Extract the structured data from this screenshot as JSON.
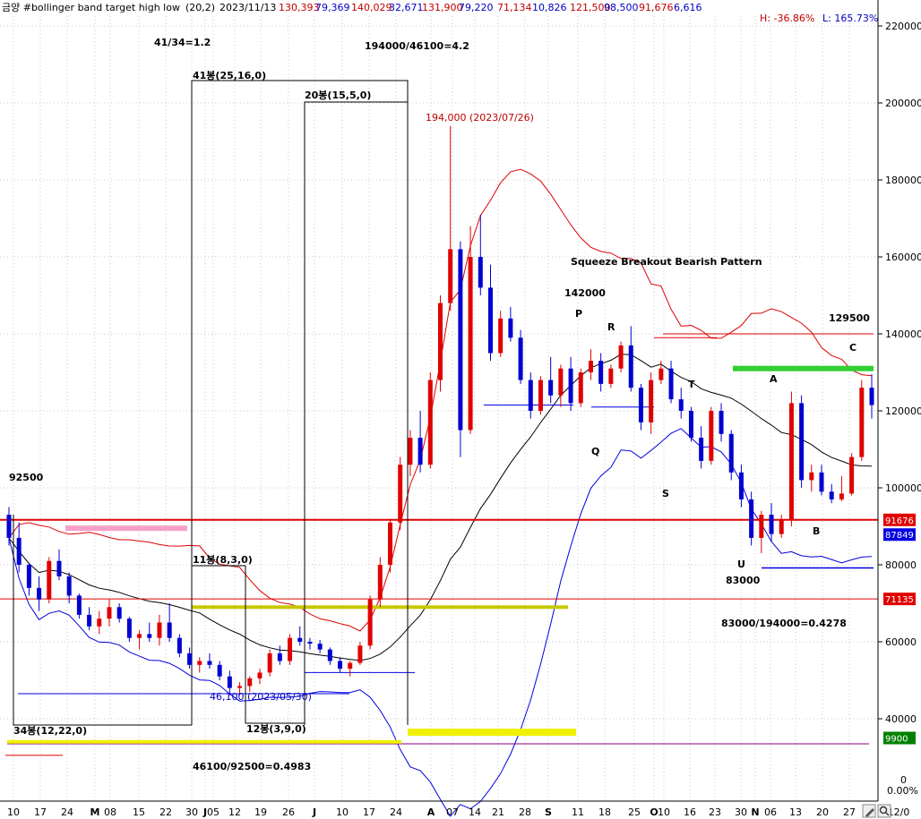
{
  "header": {
    "name": "금양 #bollinger band target high low",
    "params": "(20,2)",
    "date": "2023/11/13",
    "v1": "130,393",
    "v2": "79,369",
    "v3": "140,029",
    "v4": "32,671",
    "v5": "131,900",
    "v6": "79,220",
    "v7": "71,134",
    "v8": "10,826",
    "v9": "121,500",
    "v10": "98,500",
    "v11": "91,676",
    "v12": "6,616",
    "hi_pct": "H: -36.86%",
    "lo_pct": "L: 165.73%"
  },
  "chart_data": {
    "type": "candlestick",
    "title": "",
    "ylim": [
      30000,
      225000
    ],
    "y_ticks": [
      40000,
      60000,
      80000,
      100000,
      120000,
      140000,
      160000,
      180000,
      200000,
      220000
    ],
    "x_tick_labels": [
      "10",
      "17",
      "24",
      "M",
      "08",
      "15",
      "22",
      "30",
      "J",
      "05",
      "12",
      "19",
      "26",
      "J",
      "10",
      "17",
      "24",
      "A",
      "07",
      "14",
      "21",
      "28",
      "S",
      "11",
      "18",
      "25",
      "O",
      "10",
      "16",
      "23",
      "30",
      "N",
      "06",
      "13",
      "20",
      "27",
      "12/0"
    ],
    "grid": true,
    "price_tags": [
      {
        "text": "91676",
        "value": 91676,
        "color": "#e00000"
      },
      {
        "text": "87849",
        "value": 87849,
        "color": "#0000e0"
      },
      {
        "text": "71135",
        "value": 71135,
        "color": "#e00000"
      },
      {
        "text": "9900",
        "value": 35000,
        "color": "#008000"
      }
    ],
    "annotations": [
      {
        "text": "41/34=1.2"
      },
      {
        "text": "194000/46100=4.2"
      },
      {
        "text": "41봉(25,16,0)"
      },
      {
        "text": "20봉(15,5,0)"
      },
      {
        "text": "194,000 (2023/07/26)"
      },
      {
        "text": "Squeeze Breakout Bearish Pattern"
      },
      {
        "text": "142000"
      },
      {
        "text": "P"
      },
      {
        "text": "R"
      },
      {
        "text": "Q"
      },
      {
        "text": "T"
      },
      {
        "text": "S"
      },
      {
        "text": "U"
      },
      {
        "text": "A"
      },
      {
        "text": "B"
      },
      {
        "text": "C"
      },
      {
        "text": "83000"
      },
      {
        "text": "129500"
      },
      {
        "text": "92500"
      },
      {
        "text": "11봉(8,3,0)"
      },
      {
        "text": "46,100 (2023/05/30)"
      },
      {
        "text": "34봉(12,22,0)"
      },
      {
        "text": "12봉(3,9,0)"
      },
      {
        "text": "46100/92500=0.4983"
      },
      {
        "text": "83000/194000=0.4278"
      }
    ],
    "extra_tag": "0",
    "extra_pct": "0.00%",
    "candles": [
      [
        93000,
        95000,
        85000,
        87000
      ],
      [
        87000,
        91000,
        78000,
        80000
      ],
      [
        80000,
        80500,
        72000,
        74000
      ],
      [
        74000,
        77000,
        68000,
        71000
      ],
      [
        71000,
        82000,
        70000,
        81000
      ],
      [
        81000,
        84000,
        76000,
        77000
      ],
      [
        77000,
        78000,
        70000,
        72000
      ],
      [
        72000,
        72500,
        66000,
        67000
      ],
      [
        67000,
        69000,
        63000,
        64000
      ],
      [
        64000,
        68000,
        62000,
        66000
      ],
      [
        66000,
        71000,
        64000,
        69000
      ],
      [
        69000,
        70000,
        65000,
        66000
      ],
      [
        66000,
        66500,
        60000,
        61000
      ],
      [
        61000,
        63000,
        58000,
        62000
      ],
      [
        62000,
        65000,
        60000,
        61000
      ],
      [
        61000,
        67000,
        59000,
        65000
      ],
      [
        65000,
        70000,
        60000,
        61000
      ],
      [
        61000,
        62000,
        56000,
        57000
      ],
      [
        57000,
        58500,
        53000,
        54000
      ],
      [
        54000,
        56000,
        52000,
        55000
      ],
      [
        55000,
        57000,
        53000,
        54000
      ],
      [
        54000,
        55000,
        50000,
        51000
      ],
      [
        51000,
        52500,
        46100,
        48000
      ],
      [
        48000,
        49500,
        46100,
        48500
      ],
      [
        48500,
        51000,
        47000,
        50500
      ],
      [
        50500,
        53000,
        49000,
        52000
      ],
      [
        52000,
        58000,
        51000,
        57000
      ],
      [
        57000,
        59000,
        54000,
        55000
      ],
      [
        55000,
        62000,
        54000,
        61000
      ],
      [
        61000,
        64000,
        59000,
        60000
      ],
      [
        60000,
        61000,
        58000,
        59500
      ],
      [
        59500,
        60500,
        57000,
        58000
      ],
      [
        58000,
        58500,
        54000,
        55000
      ],
      [
        55000,
        56000,
        52000,
        53000
      ],
      [
        53000,
        55000,
        51000,
        54500
      ],
      [
        54500,
        60000,
        54000,
        59000
      ],
      [
        59000,
        72000,
        58000,
        71000
      ],
      [
        71000,
        82000,
        69000,
        80000
      ],
      [
        80000,
        92000,
        78000,
        91000
      ],
      [
        91000,
        108000,
        89000,
        106000
      ],
      [
        106000,
        115000,
        103000,
        113000
      ],
      [
        113000,
        120000,
        104000,
        106000
      ],
      [
        106000,
        130000,
        105000,
        128000
      ],
      [
        128000,
        150000,
        125000,
        148000
      ],
      [
        148000,
        194000,
        146000,
        162000
      ],
      [
        162000,
        164000,
        108000,
        115000
      ],
      [
        115000,
        168000,
        114000,
        160000
      ],
      [
        160000,
        171000,
        150000,
        152000
      ],
      [
        152000,
        158000,
        133000,
        135000
      ],
      [
        135000,
        146000,
        134000,
        144000
      ],
      [
        144000,
        147000,
        138000,
        139000
      ],
      [
        139000,
        141000,
        127000,
        128000
      ],
      [
        128000,
        130000,
        118000,
        120000
      ],
      [
        120000,
        129000,
        119000,
        128000
      ],
      [
        128000,
        134000,
        122000,
        124000
      ],
      [
        124000,
        132000,
        121000,
        131000
      ],
      [
        131000,
        134000,
        120000,
        122000
      ],
      [
        122000,
        131000,
        121000,
        130000
      ],
      [
        130000,
        136000,
        128000,
        133000
      ],
      [
        133000,
        135000,
        125000,
        127000
      ],
      [
        127000,
        132000,
        126000,
        131000
      ],
      [
        131000,
        138000,
        130000,
        137000
      ],
      [
        137000,
        142000,
        125000,
        126000
      ],
      [
        126000,
        127000,
        115000,
        117000
      ],
      [
        117000,
        130000,
        114000,
        128000
      ],
      [
        128000,
        133000,
        127000,
        131000
      ],
      [
        131000,
        133000,
        122000,
        123000
      ],
      [
        123000,
        126000,
        118000,
        120000
      ],
      [
        120000,
        121000,
        112000,
        113000
      ],
      [
        113000,
        116000,
        105000,
        107000
      ],
      [
        107000,
        121000,
        106000,
        120000
      ],
      [
        120000,
        122000,
        112000,
        114000
      ],
      [
        114000,
        115000,
        102000,
        104000
      ],
      [
        104000,
        106000,
        95000,
        97000
      ],
      [
        97000,
        99000,
        85000,
        87000
      ],
      [
        87000,
        94000,
        83000,
        93000
      ],
      [
        93000,
        96000,
        86000,
        88000
      ],
      [
        88000,
        93000,
        87000,
        91500
      ],
      [
        91500,
        125000,
        90000,
        122000
      ],
      [
        122000,
        124000,
        100000,
        102000
      ],
      [
        102000,
        106000,
        99000,
        104000
      ],
      [
        104000,
        106000,
        98000,
        99000
      ],
      [
        99000,
        101000,
        96000,
        97000
      ],
      [
        97000,
        103000,
        96500,
        98500
      ],
      [
        98500,
        109000,
        98000,
        108000
      ],
      [
        108000,
        128000,
        107000,
        126000
      ],
      [
        126000,
        129500,
        118000,
        121500
      ]
    ]
  }
}
